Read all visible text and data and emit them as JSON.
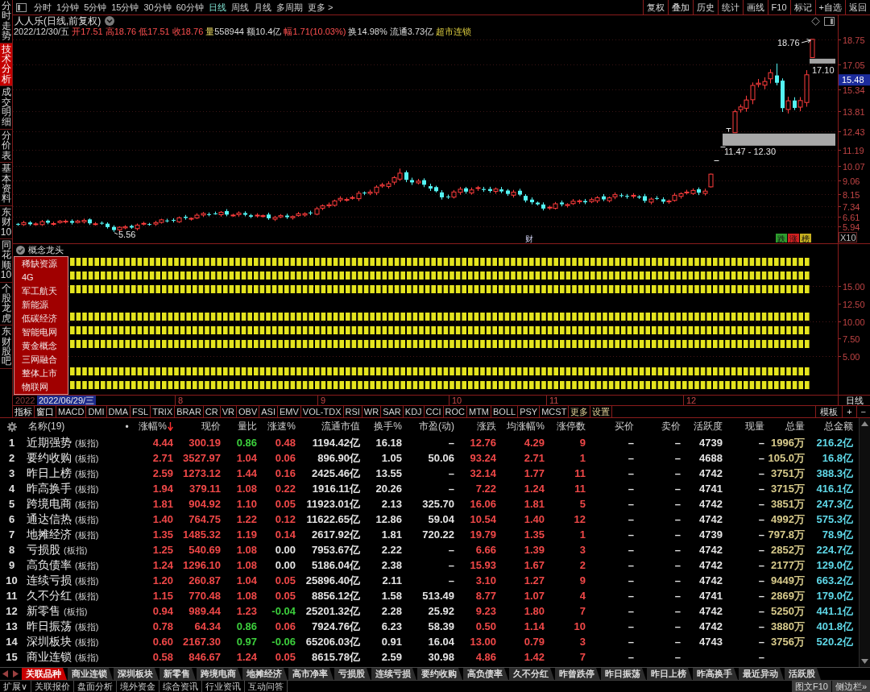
{
  "sidebar_tabs": [
    {
      "label": "分时走势",
      "selected": false
    },
    {
      "label": "技术分析",
      "selected": true
    },
    {
      "label": "成交明细",
      "selected": false
    },
    {
      "label": "分价表",
      "selected": false
    },
    {
      "label": "基本资料",
      "selected": false
    },
    {
      "label": "东财10",
      "selected": false
    },
    {
      "label": "同花顺10",
      "selected": false
    },
    {
      "label": "个股龙虎",
      "selected": false
    },
    {
      "label": "东财股吧",
      "selected": false
    }
  ],
  "toolbar": {
    "periods": [
      {
        "label": "分时",
        "selected": false
      },
      {
        "label": "1分钟",
        "selected": false
      },
      {
        "label": "5分钟",
        "selected": false
      },
      {
        "label": "15分钟",
        "selected": false
      },
      {
        "label": "30分钟",
        "selected": false
      },
      {
        "label": "60分钟",
        "selected": false
      },
      {
        "label": "日线",
        "selected": true
      },
      {
        "label": "周线",
        "selected": false
      },
      {
        "label": "月线",
        "selected": false
      },
      {
        "label": "多周期",
        "selected": false
      },
      {
        "label": "更多 >",
        "selected": false
      }
    ],
    "tools": [
      "复权",
      "叠加",
      "历史",
      "统计",
      "画线",
      "F10",
      "标记",
      "+自选",
      "返回"
    ]
  },
  "chart": {
    "title": "人人乐(日线,前复权)",
    "date": "2022/12/30/五",
    "quote": [
      {
        "label": "开",
        "value": "17.51",
        "kind": "price"
      },
      {
        "label": "高",
        "value": "18.76",
        "kind": "price"
      },
      {
        "label": "低",
        "value": "17.51",
        "kind": "price"
      },
      {
        "label": "收",
        "value": "18.76",
        "kind": "price"
      },
      {
        "label": "量",
        "value": "558944",
        "kind": "volume"
      },
      {
        "label": "额",
        "value": "10.4亿",
        "kind": "plain"
      },
      {
        "label": "幅",
        "value": "1.71(10.03%)",
        "kind": "price"
      },
      {
        "label": "换",
        "value": "14.98%",
        "kind": "plain"
      },
      {
        "label": "流通",
        "value": "3.73亿",
        "kind": "plain"
      }
    ],
    "sector": "超市连锁",
    "price_axis": [
      "18.75",
      "17.05",
      "15.34",
      "13.81",
      "12.43",
      "11.19",
      "10.07",
      "9.06",
      "8.15",
      "7.34",
      "6.61",
      "5.94"
    ],
    "cursor_price": "15.48",
    "annotations": {
      "high": "18.76",
      "level": "17.10",
      "gap": "11.47 - 12.30",
      "low": "5.56"
    },
    "marker": "财",
    "event_badges": [
      {
        "label": "跌",
        "color": "#2e9e2e"
      },
      {
        "label": "涨",
        "color": "#d02020"
      },
      {
        "label": "榜",
        "color": "#c8b020"
      }
    ],
    "scale": "X10"
  },
  "indicator": {
    "title": "概念龙头",
    "concepts": [
      {
        "label": "稀缺资源",
        "signal": true
      },
      {
        "label": "4G",
        "signal": true
      },
      {
        "label": "军工航天",
        "signal": true
      },
      {
        "label": "新能源",
        "signal": false
      },
      {
        "label": "低碳经济",
        "signal": true
      },
      {
        "label": "智能电网",
        "signal": true
      },
      {
        "label": "黄金概念",
        "signal": true
      },
      {
        "label": "三网融合",
        "signal": false
      },
      {
        "label": "整体上市",
        "signal": true
      },
      {
        "label": "物联网",
        "signal": true
      }
    ],
    "axis": [
      "15.00",
      "12.50",
      "10.00",
      "7.50",
      "5.00"
    ]
  },
  "date_axis": {
    "year": "2022",
    "cursor_date": "2022/06/29/三",
    "months": [
      "8",
      "9",
      "10",
      "11",
      "12"
    ],
    "period": "日线"
  },
  "indicator_tabs": {
    "items": [
      {
        "label": "指标",
        "kind": "menu"
      },
      {
        "label": "窗口",
        "kind": "menu"
      },
      {
        "label": "MACD",
        "kind": "formula"
      },
      {
        "label": "DMI",
        "kind": "formula"
      },
      {
        "label": "DMA",
        "kind": "formula"
      },
      {
        "label": "FSL",
        "kind": "formula"
      },
      {
        "label": "TRIX",
        "kind": "formula"
      },
      {
        "label": "BRAR",
        "kind": "formula"
      },
      {
        "label": "CR",
        "kind": "formula"
      },
      {
        "label": "VR",
        "kind": "formula"
      },
      {
        "label": "OBV",
        "kind": "formula"
      },
      {
        "label": "ASI",
        "kind": "formula"
      },
      {
        "label": "EMV",
        "kind": "formula"
      },
      {
        "label": "VOL-TDX",
        "kind": "formula"
      },
      {
        "label": "RSI",
        "kind": "formula"
      },
      {
        "label": "WR",
        "kind": "formula"
      },
      {
        "label": "SAR",
        "kind": "formula"
      },
      {
        "label": "KDJ",
        "kind": "formula"
      },
      {
        "label": "CCI",
        "kind": "formula"
      },
      {
        "label": "ROC",
        "kind": "formula"
      },
      {
        "label": "MTM",
        "kind": "formula"
      },
      {
        "label": "BOLL",
        "kind": "formula"
      },
      {
        "label": "PSY",
        "kind": "formula"
      },
      {
        "label": "MCST",
        "kind": "formula"
      },
      {
        "label": "更多",
        "kind": "option"
      },
      {
        "label": "设置",
        "kind": "option"
      }
    ],
    "tools": [
      "模板",
      "+",
      "−"
    ]
  },
  "table": {
    "columns": [
      {
        "label": "名称(19)",
        "sorted": false
      },
      {
        "label": "•",
        "sorted": false
      },
      {
        "label": "涨幅%",
        "sorted": true
      },
      {
        "label": "现价",
        "sorted": false
      },
      {
        "label": "量比",
        "sorted": false
      },
      {
        "label": "涨速%",
        "sorted": false
      },
      {
        "label": "流通市值",
        "sorted": false
      },
      {
        "label": "换手%",
        "sorted": false
      },
      {
        "label": "市盈(动)",
        "sorted": false
      },
      {
        "label": "涨跌",
        "sorted": false
      },
      {
        "label": "均涨幅%",
        "sorted": false
      },
      {
        "label": "涨停数",
        "sorted": false
      },
      {
        "label": "买价",
        "sorted": false
      },
      {
        "label": "卖价",
        "sorted": false
      },
      {
        "label": "活跃度",
        "sorted": false
      },
      {
        "label": "现量",
        "sorted": false
      },
      {
        "label": "总量",
        "sorted": false
      },
      {
        "label": "总金额",
        "sorted": false
      }
    ],
    "rows": [
      {
        "rank": "1",
        "name": "近期强势",
        "tag": "(板指)",
        "change_pct": "4.44",
        "price": "300.19",
        "volume_ratio": "0.86",
        "speed": "0.48",
        "float_cap": "1194.42亿",
        "turnover": "16.18",
        "pe": "–",
        "change": "12.76",
        "avg_change": "4.29",
        "limit_ups": "9",
        "bid": "–",
        "ask": "–",
        "activity": "4739",
        "last_volume": "–",
        "volume": "1996万",
        "amount": "216.2亿"
      },
      {
        "rank": "2",
        "name": "要约收购",
        "tag": "(板指)",
        "change_pct": "2.71",
        "price": "3527.97",
        "volume_ratio": "1.04",
        "speed": "0.06",
        "float_cap": "896.90亿",
        "turnover": "1.05",
        "pe": "50.06",
        "change": "93.24",
        "avg_change": "2.71",
        "limit_ups": "1",
        "bid": "–",
        "ask": "–",
        "activity": "4688",
        "last_volume": "–",
        "volume": "105.0万",
        "amount": "16.8亿"
      },
      {
        "rank": "3",
        "name": "昨日上榜",
        "tag": "(板指)",
        "change_pct": "2.59",
        "price": "1273.12",
        "volume_ratio": "1.44",
        "speed": "0.16",
        "float_cap": "2425.46亿",
        "turnover": "13.55",
        "pe": "–",
        "change": "32.14",
        "avg_change": "1.77",
        "limit_ups": "11",
        "bid": "–",
        "ask": "–",
        "activity": "4742",
        "last_volume": "–",
        "volume": "3751万",
        "amount": "388.3亿"
      },
      {
        "rank": "4",
        "name": "昨高换手",
        "tag": "(板指)",
        "change_pct": "1.94",
        "price": "379.11",
        "volume_ratio": "1.08",
        "speed": "0.22",
        "float_cap": "1916.11亿",
        "turnover": "20.26",
        "pe": "–",
        "change": "7.22",
        "avg_change": "1.24",
        "limit_ups": "11",
        "bid": "–",
        "ask": "–",
        "activity": "4741",
        "last_volume": "–",
        "volume": "3715万",
        "amount": "416.1亿"
      },
      {
        "rank": "5",
        "name": "跨境电商",
        "tag": "(板指)",
        "change_pct": "1.81",
        "price": "904.92",
        "volume_ratio": "1.10",
        "speed": "0.05",
        "float_cap": "11923.01亿",
        "turnover": "2.13",
        "pe": "325.70",
        "change": "16.06",
        "avg_change": "1.81",
        "limit_ups": "5",
        "bid": "–",
        "ask": "–",
        "activity": "4742",
        "last_volume": "–",
        "volume": "3851万",
        "amount": "247.3亿"
      },
      {
        "rank": "6",
        "name": "通达信热",
        "tag": "(板指)",
        "change_pct": "1.40",
        "price": "764.75",
        "volume_ratio": "1.22",
        "speed": "0.12",
        "float_cap": "11622.65亿",
        "turnover": "12.86",
        "pe": "59.04",
        "change": "10.54",
        "avg_change": "1.40",
        "limit_ups": "12",
        "bid": "–",
        "ask": "–",
        "activity": "4742",
        "last_volume": "–",
        "volume": "4992万",
        "amount": "575.3亿"
      },
      {
        "rank": "7",
        "name": "地摊经济",
        "tag": "(板指)",
        "change_pct": "1.35",
        "price": "1485.32",
        "volume_ratio": "1.19",
        "speed": "0.14",
        "float_cap": "2617.92亿",
        "turnover": "1.81",
        "pe": "720.22",
        "change": "19.79",
        "avg_change": "1.35",
        "limit_ups": "1",
        "bid": "–",
        "ask": "–",
        "activity": "4739",
        "last_volume": "–",
        "volume": "797.8万",
        "amount": "78.9亿"
      },
      {
        "rank": "8",
        "name": "亏损股",
        "tag": "(板指)",
        "change_pct": "1.25",
        "price": "540.69",
        "volume_ratio": "1.08",
        "speed": "0.00",
        "float_cap": "7953.67亿",
        "turnover": "2.22",
        "pe": "–",
        "change": "6.66",
        "avg_change": "1.39",
        "limit_ups": "3",
        "bid": "–",
        "ask": "–",
        "activity": "4742",
        "last_volume": "–",
        "volume": "2852万",
        "amount": "224.7亿"
      },
      {
        "rank": "9",
        "name": "高负债率",
        "tag": "(板指)",
        "change_pct": "1.24",
        "price": "1296.10",
        "volume_ratio": "1.08",
        "speed": "0.00",
        "float_cap": "5186.04亿",
        "turnover": "2.38",
        "pe": "–",
        "change": "15.93",
        "avg_change": "1.67",
        "limit_ups": "2",
        "bid": "–",
        "ask": "–",
        "activity": "4742",
        "last_volume": "–",
        "volume": "2177万",
        "amount": "129.0亿"
      },
      {
        "rank": "10",
        "name": "连续亏损",
        "tag": "(板指)",
        "change_pct": "1.20",
        "price": "260.87",
        "volume_ratio": "1.04",
        "speed": "0.05",
        "float_cap": "25896.40亿",
        "turnover": "2.11",
        "pe": "–",
        "change": "3.10",
        "avg_change": "1.27",
        "limit_ups": "9",
        "bid": "–",
        "ask": "–",
        "activity": "4742",
        "last_volume": "–",
        "volume": "9449万",
        "amount": "663.2亿"
      },
      {
        "rank": "11",
        "name": "久不分红",
        "tag": "(板指)",
        "change_pct": "1.15",
        "price": "770.48",
        "volume_ratio": "1.08",
        "speed": "0.05",
        "float_cap": "8856.12亿",
        "turnover": "1.58",
        "pe": "513.49",
        "change": "8.77",
        "avg_change": "1.07",
        "limit_ups": "4",
        "bid": "–",
        "ask": "–",
        "activity": "4741",
        "last_volume": "–",
        "volume": "2869万",
        "amount": "179.0亿"
      },
      {
        "rank": "12",
        "name": "新零售",
        "tag": "(板指)",
        "change_pct": "0.94",
        "price": "989.44",
        "volume_ratio": "1.23",
        "speed": "-0.04",
        "float_cap": "25201.32亿",
        "turnover": "2.28",
        "pe": "25.92",
        "change": "9.23",
        "avg_change": "1.80",
        "limit_ups": "7",
        "bid": "–",
        "ask": "–",
        "activity": "4742",
        "last_volume": "–",
        "volume": "5250万",
        "amount": "441.1亿"
      },
      {
        "rank": "13",
        "name": "昨日振荡",
        "tag": "(板指)",
        "change_pct": "0.78",
        "price": "64.34",
        "volume_ratio": "0.86",
        "speed": "0.06",
        "float_cap": "7924.76亿",
        "turnover": "6.23",
        "pe": "58.39",
        "change": "0.50",
        "avg_change": "1.14",
        "limit_ups": "10",
        "bid": "–",
        "ask": "–",
        "activity": "4742",
        "last_volume": "–",
        "volume": "3880万",
        "amount": "401.8亿"
      },
      {
        "rank": "14",
        "name": "深圳板块",
        "tag": "(板指)",
        "change_pct": "0.60",
        "price": "2167.30",
        "volume_ratio": "0.97",
        "speed": "-0.06",
        "float_cap": "65206.03亿",
        "turnover": "0.91",
        "pe": "16.04",
        "change": "13.00",
        "avg_change": "0.79",
        "limit_ups": "3",
        "bid": "–",
        "ask": "–",
        "activity": "4743",
        "last_volume": "–",
        "volume": "3756万",
        "amount": "520.2亿"
      },
      {
        "rank": "15",
        "name": "商业连锁",
        "tag": "(板指)",
        "change_pct": "0.58",
        "price": "846.67",
        "volume_ratio": "1.24",
        "speed": "0.05",
        "float_cap": "8615.78亿",
        "turnover": "2.59",
        "pe": "30.98",
        "change": "4.86",
        "avg_change": "1.42",
        "limit_ups": "7",
        "bid": "–",
        "ask": "–",
        "last_volume": "–"
      }
    ]
  },
  "bottom_tabs": [
    {
      "label": "关联品种",
      "selected": true
    },
    {
      "label": "商业连锁",
      "selected": false
    },
    {
      "label": "深圳板块",
      "selected": false
    },
    {
      "label": "新零售",
      "selected": false
    },
    {
      "label": "跨境电商",
      "selected": false
    },
    {
      "label": "地摊经济",
      "selected": false
    },
    {
      "label": "高市净率",
      "selected": false
    },
    {
      "label": "亏损股",
      "selected": false
    },
    {
      "label": "连续亏损",
      "selected": false
    },
    {
      "label": "要约收购",
      "selected": false
    },
    {
      "label": "高负债率",
      "selected": false
    },
    {
      "label": "久不分红",
      "selected": false
    },
    {
      "label": "昨曾跌停",
      "selected": false
    },
    {
      "label": "昨日振荡",
      "selected": false
    },
    {
      "label": "昨日上榜",
      "selected": false
    },
    {
      "label": "昨高换手",
      "selected": false
    },
    {
      "label": "最近异动",
      "selected": false
    },
    {
      "label": "活跃股",
      "selected": false
    }
  ],
  "bottom_bar": {
    "left": [
      "扩展∨",
      "关联报价",
      "盘面分析",
      "境外资金",
      "综合资讯",
      "行业资讯",
      "互动问答"
    ],
    "right": [
      "图文F10",
      "侧边栏»"
    ]
  }
}
